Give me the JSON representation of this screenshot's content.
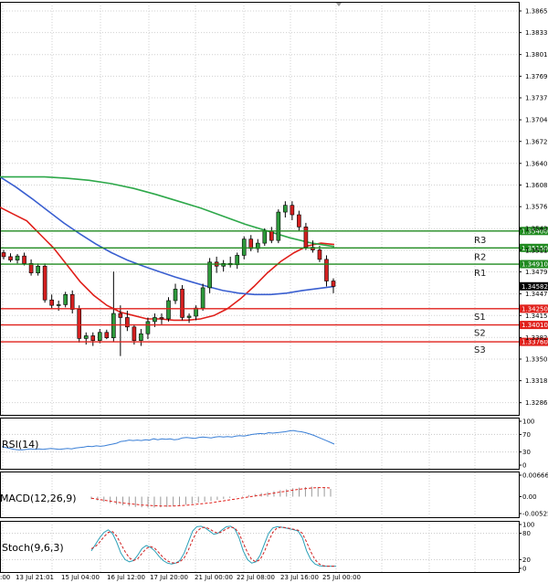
{
  "chart_data": {
    "type": "candlestick",
    "price_axis": {
      "ticks": [
        "1.38655",
        "1.38335",
        "1.38010",
        "1.37690",
        "1.37370",
        "1.37045",
        "1.36725",
        "1.36400",
        "1.36080",
        "1.35760",
        "1.35435",
        "1.35115",
        "1.34795",
        "1.34470",
        "1.34150",
        "1.33825",
        "1.33505",
        "1.33185",
        "1.32860"
      ],
      "ylim": [
        1.3268,
        1.3879
      ]
    },
    "time_axis": {
      "labels": [
        ":00",
        "13 Jul 21:01",
        "15 Jul 04:00",
        "16 Jul 12:00",
        "17 Jul 20:00",
        "21 Jul 00:00",
        "22 Jul 08:00",
        "23 Jul 16:00",
        "25 Jul 00:00"
      ]
    },
    "current_price": {
      "label": "1.34582",
      "value": 1.34582
    },
    "levels": [
      {
        "name": "R3",
        "label": "1.35400",
        "value": 1.354,
        "kind": "resistance",
        "color": "#1f8a1f"
      },
      {
        "name": "R2",
        "label": "1.35150",
        "value": 1.3515,
        "kind": "resistance",
        "color": "#1f8a1f"
      },
      {
        "name": "R1",
        "label": "1.34910",
        "value": 1.3491,
        "kind": "resistance",
        "color": "#1f8a1f"
      },
      {
        "name": "S1",
        "label": "1.34250",
        "value": 1.3425,
        "kind": "support",
        "color": "#e0201b"
      },
      {
        "name": "S2",
        "label": "1.34010",
        "value": 1.3401,
        "kind": "support",
        "color": "#e0201b"
      },
      {
        "name": "S3",
        "label": "1.33760",
        "value": 1.3376,
        "kind": "support",
        "color": "#e0201b"
      }
    ],
    "series": [
      {
        "name": "",
        "color": "#e0201b",
        "values": [
          1.3575,
          1.3565,
          1.3555,
          1.3535,
          1.3515,
          1.349,
          1.3465,
          1.3445,
          1.343,
          1.342,
          1.3415,
          1.341,
          1.341,
          1.3408,
          1.3408,
          1.341,
          1.3415,
          1.3425,
          1.344,
          1.3458,
          1.3478,
          1.3495,
          1.3508,
          1.3518,
          1.3522,
          1.352
        ]
      },
      {
        "name": "",
        "color": "#3a5fd0",
        "values": [
          1.362,
          1.3605,
          1.3588,
          1.357,
          1.3552,
          1.3536,
          1.3521,
          1.3508,
          1.3497,
          1.3488,
          1.348,
          1.3472,
          1.3465,
          1.3458,
          1.3452,
          1.3448,
          1.3446,
          1.3446,
          1.3448,
          1.3452,
          1.3455,
          1.3458
        ]
      },
      {
        "name": "",
        "color": "#2ea84a",
        "values": [
          1.362,
          1.362,
          1.362,
          1.3618,
          1.3615,
          1.361,
          1.3603,
          1.3594,
          1.3584,
          1.3574,
          1.3562,
          1.355,
          1.354,
          1.353,
          1.3522,
          1.3517
        ]
      }
    ],
    "ohlc": [
      [
        1.3508,
        1.3512,
        1.3498,
        1.3502
      ],
      [
        1.3502,
        1.3507,
        1.3494,
        1.3497
      ],
      [
        1.3497,
        1.3506,
        1.3492,
        1.3503
      ],
      [
        1.3503,
        1.3508,
        1.3489,
        1.3492
      ],
      [
        1.3492,
        1.3498,
        1.3474,
        1.3478
      ],
      [
        1.3478,
        1.3492,
        1.3474,
        1.3488
      ],
      [
        1.3488,
        1.3492,
        1.3434,
        1.3438
      ],
      [
        1.3438,
        1.3446,
        1.3425,
        1.343
      ],
      [
        1.343,
        1.3437,
        1.3422,
        1.3431
      ],
      [
        1.3431,
        1.345,
        1.3427,
        1.3446
      ],
      [
        1.3446,
        1.3452,
        1.3418,
        1.3424
      ],
      [
        1.3424,
        1.343,
        1.3375,
        1.3381
      ],
      [
        1.3381,
        1.339,
        1.3372,
        1.3385
      ],
      [
        1.3385,
        1.339,
        1.337,
        1.3378
      ],
      [
        1.3378,
        1.3395,
        1.3374,
        1.339
      ],
      [
        1.339,
        1.3394,
        1.338,
        1.3382
      ],
      [
        1.3382,
        1.348,
        1.3376,
        1.3418
      ],
      [
        1.3418,
        1.343,
        1.3355,
        1.3412
      ],
      [
        1.3412,
        1.3422,
        1.3392,
        1.3398
      ],
      [
        1.3398,
        1.3402,
        1.3372,
        1.3378
      ],
      [
        1.3378,
        1.3395,
        1.337,
        1.3388
      ],
      [
        1.3388,
        1.3412,
        1.338,
        1.3406
      ],
      [
        1.3406,
        1.3418,
        1.3398,
        1.3412
      ],
      [
        1.3412,
        1.3418,
        1.3402,
        1.341
      ],
      [
        1.341,
        1.3442,
        1.3406,
        1.3437
      ],
      [
        1.3437,
        1.3462,
        1.3432,
        1.3454
      ],
      [
        1.3454,
        1.346,
        1.3408,
        1.3412
      ],
      [
        1.3412,
        1.3418,
        1.3404,
        1.3414
      ],
      [
        1.3414,
        1.343,
        1.3408,
        1.3426
      ],
      [
        1.3426,
        1.3462,
        1.3422,
        1.3456
      ],
      [
        1.3456,
        1.35,
        1.3448,
        1.3494
      ],
      [
        1.3494,
        1.3502,
        1.3478,
        1.3488
      ],
      [
        1.3488,
        1.3497,
        1.348,
        1.3492
      ],
      [
        1.3492,
        1.3502,
        1.3486,
        1.349
      ],
      [
        1.349,
        1.3508,
        1.3484,
        1.3504
      ],
      [
        1.3504,
        1.3532,
        1.3498,
        1.3528
      ],
      [
        1.3528,
        1.3534,
        1.351,
        1.3514
      ],
      [
        1.3514,
        1.3528,
        1.3508,
        1.3522
      ],
      [
        1.3522,
        1.3544,
        1.3518,
        1.354
      ],
      [
        1.354,
        1.3546,
        1.3522,
        1.3526
      ],
      [
        1.3526,
        1.3572,
        1.3522,
        1.3568
      ],
      [
        1.3568,
        1.3584,
        1.356,
        1.3578
      ],
      [
        1.3578,
        1.3584,
        1.3556,
        1.3564
      ],
      [
        1.3564,
        1.357,
        1.354,
        1.3546
      ],
      [
        1.3546,
        1.3552,
        1.3512,
        1.3516
      ],
      [
        1.3516,
        1.3526,
        1.3508,
        1.3512
      ],
      [
        1.3512,
        1.3518,
        1.3494,
        1.3498
      ],
      [
        1.3498,
        1.3504,
        1.3458,
        1.3466
      ],
      [
        1.3466,
        1.347,
        1.3448,
        1.3458
      ]
    ],
    "indicators": [
      {
        "name": "RSI(14)",
        "ticks": [
          "100",
          "70",
          "30",
          "0"
        ],
        "ylim": [
          0,
          100
        ],
        "levels": [
          70,
          30
        ],
        "color": "#3a7fd6",
        "values": [
          42,
          40,
          38,
          36,
          35,
          35,
          36,
          37,
          36,
          37,
          36,
          37,
          38,
          37,
          36,
          37,
          38,
          37,
          39,
          40,
          41,
          43,
          42,
          44,
          43,
          44,
          46,
          48,
          50,
          54,
          55,
          57,
          56,
          57,
          56,
          58,
          57,
          60,
          58,
          60,
          59,
          60,
          58,
          59,
          62,
          63,
          62,
          61,
          63,
          64,
          63,
          62,
          64,
          65,
          64,
          65,
          64,
          66,
          67,
          66,
          68,
          70,
          71,
          72,
          71,
          74,
          73,
          74,
          75,
          76,
          78,
          79,
          77,
          76,
          74,
          71,
          68,
          64,
          60,
          56,
          52,
          48
        ]
      },
      {
        "name": "MACD(12,26,9)",
        "ticks": [
          "0.00666",
          "0.00",
          "-0.00525"
        ],
        "ylim": [
          -0.00525,
          0.00666
        ],
        "color": "#e0201b",
        "histogram": [
          -0.0008,
          -0.0012,
          -0.0016,
          -0.002,
          -0.0024,
          -0.0027,
          -0.003,
          -0.0032,
          -0.0033,
          -0.0034,
          -0.0034,
          -0.0033,
          -0.0032,
          -0.003,
          -0.0028,
          -0.0025,
          -0.0022,
          -0.0019,
          -0.0016,
          -0.0013,
          -0.001,
          -0.0007,
          -0.0004,
          -0.0001,
          0.0002,
          0.0005,
          0.0008,
          0.0011,
          0.0014,
          0.0017,
          0.002,
          0.0023,
          0.0026,
          0.0028,
          0.003,
          0.0031,
          0.003,
          0.0028,
          0.0024
        ],
        "signal": [
          -0.0005,
          -0.0008,
          -0.0011,
          -0.0014,
          -0.0017,
          -0.002,
          -0.0022,
          -0.0024,
          -0.0026,
          -0.0027,
          -0.0028,
          -0.0029,
          -0.0029,
          -0.0029,
          -0.0028,
          -0.0027,
          -0.0025,
          -0.0023,
          -0.0021,
          -0.0019,
          -0.0016,
          -0.0013,
          -0.001,
          -0.0007,
          -0.0004,
          -0.0001,
          0.0002,
          0.0005,
          0.0008,
          0.0011,
          0.0014,
          0.0017,
          0.002,
          0.0023,
          0.0025,
          0.0027,
          0.0028,
          0.0028,
          0.0027
        ]
      },
      {
        "name": "Stoch(9,6,3)",
        "ticks": [
          "100",
          "80",
          "20",
          "0"
        ],
        "ylim": [
          0,
          100
        ],
        "levels": [
          80,
          20
        ],
        "main_color": "#2aa0b8",
        "signal_color": "#d02020",
        "main": [
          40,
          55,
          70,
          82,
          88,
          80,
          60,
          35,
          20,
          15,
          18,
          30,
          45,
          52,
          48,
          40,
          28,
          18,
          12,
          10,
          12,
          18,
          35,
          60,
          85,
          95,
          96,
          92,
          85,
          78,
          80,
          88,
          95,
          96,
          90,
          70,
          40,
          20,
          12,
          15,
          30,
          55,
          80,
          92,
          95,
          94,
          92,
          90,
          88,
          85,
          70,
          40,
          20,
          10,
          6,
          5,
          5,
          5,
          5
        ],
        "signal": [
          45,
          50,
          60,
          72,
          82,
          84,
          74,
          56,
          38,
          24,
          18,
          22,
          34,
          45,
          50,
          46,
          36,
          25,
          17,
          13,
          12,
          15,
          24,
          42,
          65,
          84,
          92,
          94,
          90,
          84,
          80,
          84,
          90,
          94,
          92,
          80,
          58,
          36,
          20,
          15,
          20,
          38,
          62,
          82,
          92,
          94,
          93,
          91,
          89,
          87,
          80,
          60,
          38,
          20,
          10,
          6,
          5,
          5,
          5
        ]
      }
    ]
  }
}
